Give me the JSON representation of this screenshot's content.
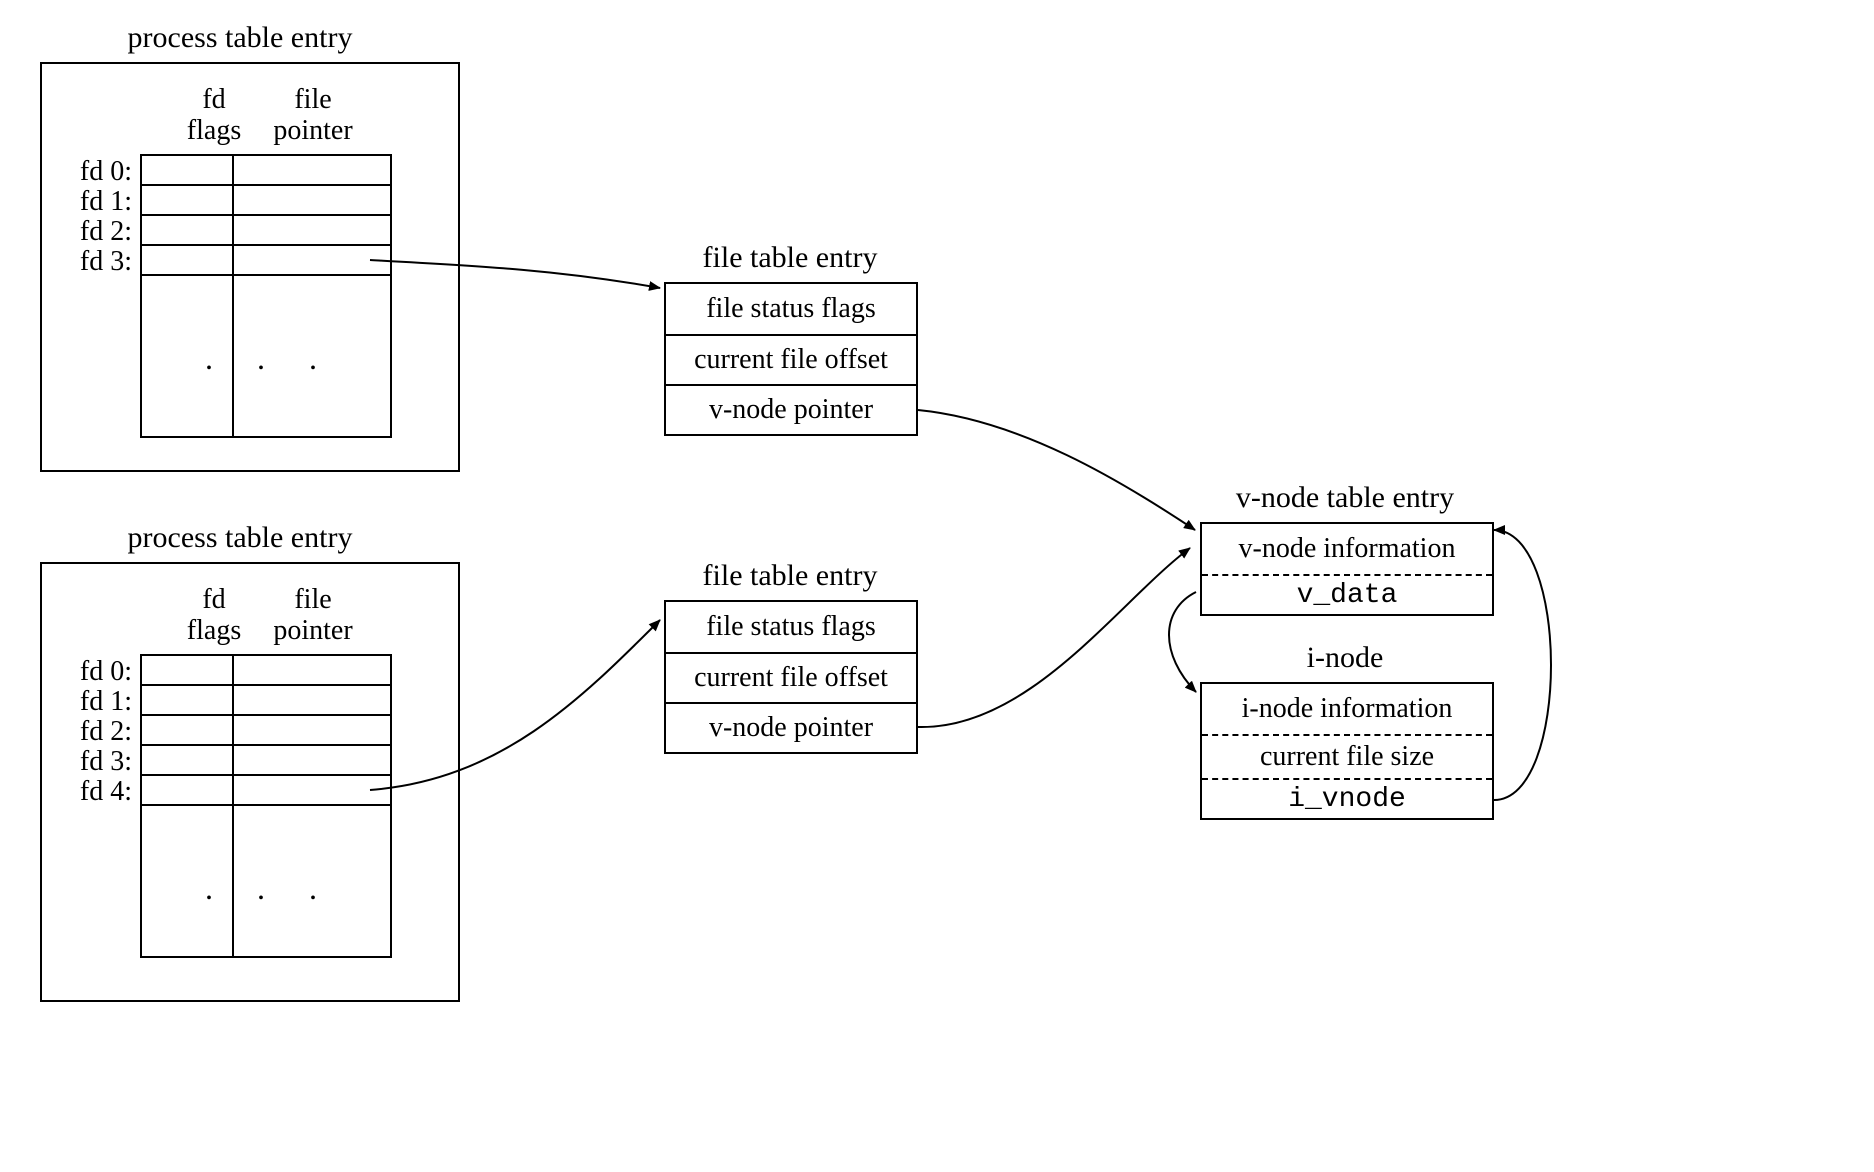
{
  "titles": {
    "process_table_entry": "process table entry",
    "file_table_entry": "file table entry",
    "vnode_table_entry": "v-node table entry",
    "inode": "i-node"
  },
  "fd_columns": {
    "flags": "fd\nflags",
    "pointer": "file\npointer"
  },
  "proc1": {
    "fds": [
      "fd 0:",
      "fd 1:",
      "fd 2:",
      "fd 3:"
    ],
    "ellipsis": ". . ."
  },
  "proc2": {
    "fds": [
      "fd 0:",
      "fd 1:",
      "fd 2:",
      "fd 3:",
      "fd 4:"
    ],
    "ellipsis": ". . ."
  },
  "file_table": {
    "status_flags": "file status flags",
    "offset": "current file offset",
    "vnode_ptr": "v-node pointer"
  },
  "vnode": {
    "info": "v-node information",
    "v_data": "v_data"
  },
  "inode_box": {
    "info": "i-node information",
    "size": "current file size",
    "i_vnode": "i_vnode"
  }
}
